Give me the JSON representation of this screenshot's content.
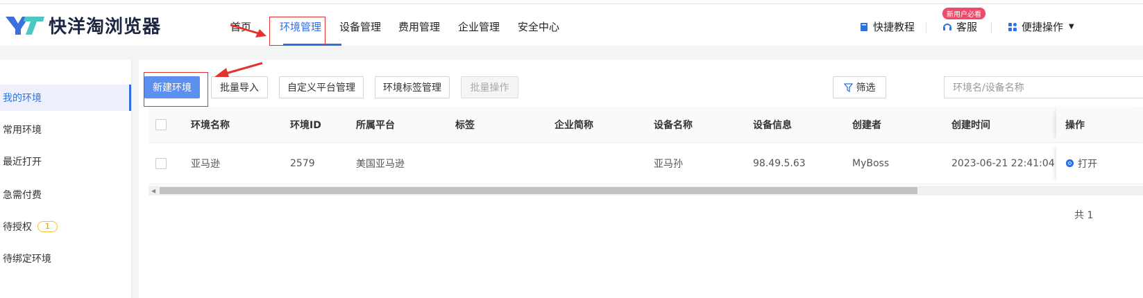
{
  "app": {
    "name": "快洋淘浏览器",
    "logo_mark": "YT"
  },
  "nav": {
    "items": [
      {
        "label": "首页",
        "active": false
      },
      {
        "label": "环境管理",
        "active": true
      },
      {
        "label": "设备管理",
        "active": false
      },
      {
        "label": "费用管理",
        "active": false
      },
      {
        "label": "企业管理",
        "active": false
      },
      {
        "label": "安全中心",
        "active": false
      }
    ]
  },
  "header_tools": {
    "tutorial_label": "快捷教程",
    "new_user_badge": "新用户必看",
    "service_label": "客服",
    "quick_ops_label": "便捷操作"
  },
  "sidebar": {
    "items": [
      {
        "label": "我的环境",
        "active": true
      },
      {
        "label": "常用环境",
        "active": false
      },
      {
        "label": "最近打开",
        "active": false
      },
      {
        "label": "急需付费",
        "active": false
      },
      {
        "label": "待授权",
        "active": false,
        "count": "1"
      },
      {
        "label": "待绑定环境",
        "active": false
      }
    ]
  },
  "toolbar": {
    "new_env": "新建环境",
    "batch_import": "批量导入",
    "custom_platform": "自定义平台管理",
    "tag_manage": "环境标签管理",
    "batch_ops": "批量操作",
    "filter": "筛选",
    "search_placeholder": "环境名/设备名称"
  },
  "table": {
    "columns": [
      "环境名称",
      "环境ID",
      "所属平台",
      "标签",
      "企业简称",
      "设备名称",
      "设备信息",
      "创建者",
      "创建时间",
      "操作"
    ],
    "rows": [
      {
        "env_name": "亚马逊",
        "env_id": "2579",
        "platform": "美国亚马逊",
        "tag": "",
        "company": "",
        "device_name": "亚马孙",
        "device_info": "98.49.5.63",
        "creator": "MyBoss",
        "created_at": "2023-06-21 22:41:04",
        "action": "打开"
      }
    ],
    "total_label": "共 1"
  },
  "colors": {
    "accent": "#2f6fe4",
    "primary_button": "#5b8ff0",
    "annotation_red": "#e5322d",
    "badge_pink": "#ef4a6c"
  }
}
